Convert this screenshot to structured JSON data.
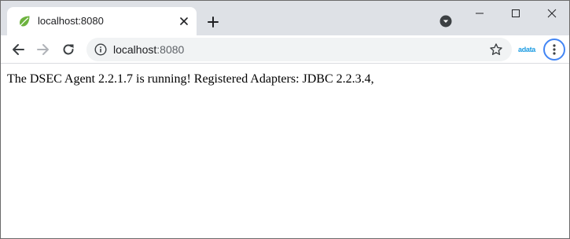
{
  "tab": {
    "title": "localhost:8080",
    "favicon": "spring-leaf-icon"
  },
  "toolbar": {
    "url_host": "localhost",
    "url_port": ":8080",
    "extension_label": "adata"
  },
  "page": {
    "text": "The DSEC Agent 2.2.1.7 is running! Registered Adapters: JDBC 2.2.3.4,"
  },
  "colors": {
    "tabstrip": "#dee1e6",
    "omnibox": "#f1f3f4",
    "accent": "#4285f4",
    "favicon": "#6db33f"
  }
}
